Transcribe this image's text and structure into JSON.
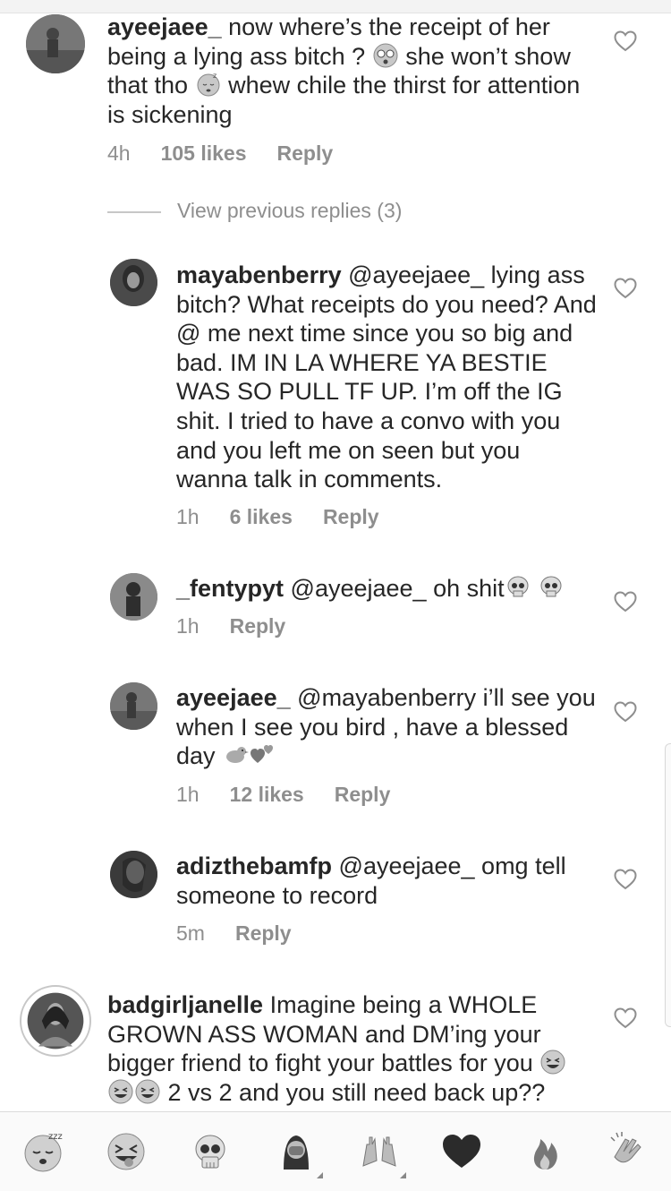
{
  "comments": [
    {
      "username": "ayeejaee_",
      "parts": [
        "now where’s the receipt of her being a lying ass bitch ?",
        "she won’t show that tho",
        "whew chile the thirst for attention is sickening"
      ],
      "emojis": [
        "face-with-spiral-eyes",
        "sleeping-face"
      ],
      "time": "4h",
      "likes": "105 likes",
      "reply": "Reply"
    },
    {
      "view_previous": "View previous replies (3)"
    },
    {
      "username": "mayabenberry",
      "text": "@ayeejaee_ lying ass bitch? What receipts do you need? And @ me next time since you so big and bad. IM IN LA WHERE YA BESTIE WAS SO PULL TF UP. I’m off the IG shit. I tried to have a convo with you and you left me on seen but you wanna talk in comments.",
      "time": "1h",
      "likes": "6 likes",
      "reply": "Reply"
    },
    {
      "username": "_fentypyt",
      "text": "@ayeejaee_ oh shit",
      "emojis": [
        "skull",
        "skull"
      ],
      "time": "1h",
      "reply": "Reply"
    },
    {
      "username": "ayeejaee_",
      "text": "@mayabenberry i’ll see you when I see you bird , have a blessed day",
      "emojis": [
        "bird",
        "two-hearts"
      ],
      "time": "1h",
      "likes": "12 likes",
      "reply": "Reply"
    },
    {
      "username": "adizthebamfp",
      "text": "@ayeejaee_ omg tell someone to record",
      "time": "5m",
      "reply": "Reply"
    },
    {
      "username": "badgirljanelle",
      "parts": [
        "Imagine being a WHOLE GROWN ASS WOMAN and DM’ing your bigger friend to fight your battles for you",
        "2 vs 2 and you still need back up??"
      ],
      "emojis": [
        "grinning-squinting-face",
        "grinning-squinting-face",
        "grinning-squinting-face"
      ]
    }
  ],
  "emoji_bar": [
    "sleeping-face",
    "squinting-tongue-face",
    "skull",
    "facepalm",
    "raising-hands",
    "black-heart",
    "fire",
    "clapping-hands"
  ]
}
